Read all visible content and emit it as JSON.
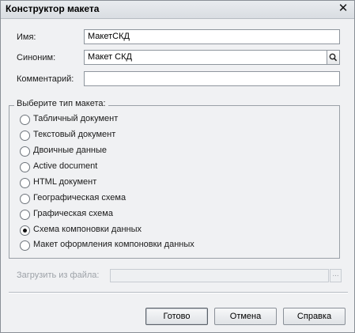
{
  "window": {
    "title": "Конструктор макета",
    "close_icon": "close-icon"
  },
  "form": {
    "name_label": "Имя:",
    "name_value": "МакетСКД",
    "synonym_label": "Синоним:",
    "synonym_value": "Макет СКД",
    "synonym_button_icon": "magnifier-icon",
    "comment_label": "Комментарий:",
    "comment_value": ""
  },
  "layout_type": {
    "legend": "Выберите тип макета:",
    "selected_index": 7,
    "options": [
      "Табличный документ",
      "Текстовый документ",
      "Двоичные данные",
      "Active document",
      "HTML документ",
      "Географическая схема",
      "Графическая схема",
      "Схема компоновки данных",
      "Макет оформления компоновки данных"
    ]
  },
  "load": {
    "label": "Загрузить из файла:",
    "value": "",
    "browse_label": "..."
  },
  "buttons": {
    "ok": "Готово",
    "cancel": "Отмена",
    "help": "Справка"
  }
}
